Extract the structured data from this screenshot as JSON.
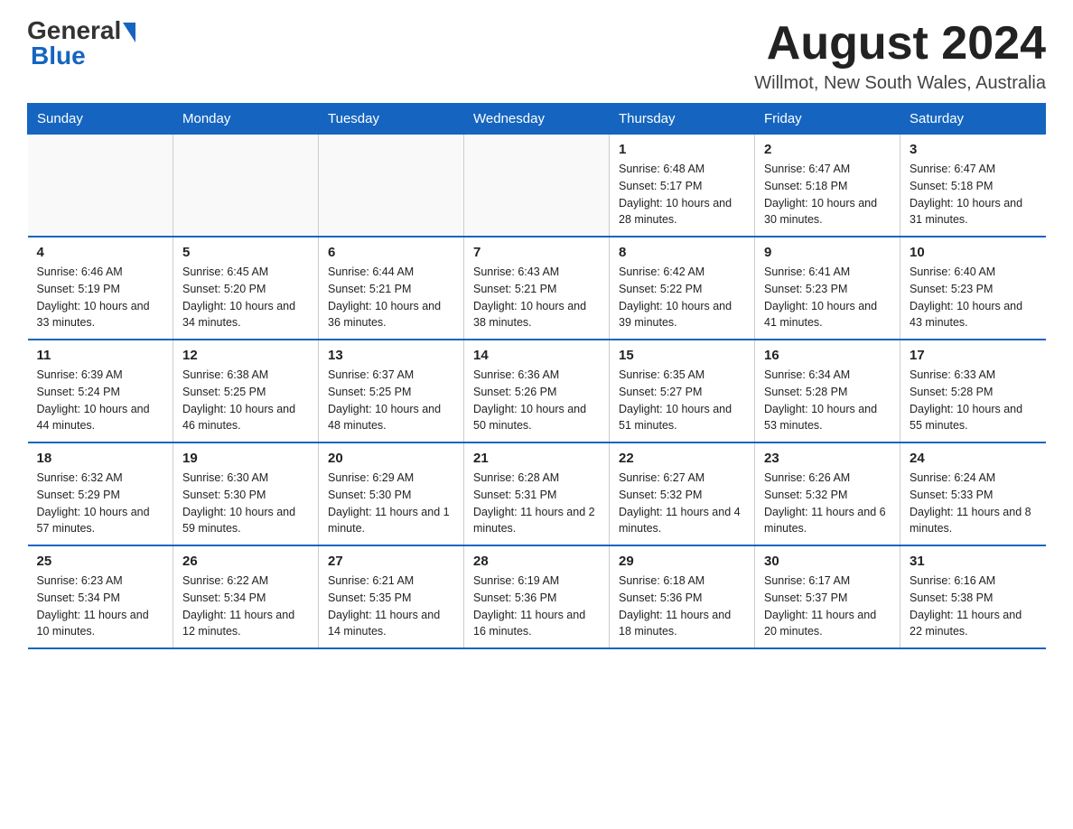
{
  "logo": {
    "general": "General",
    "blue": "Blue"
  },
  "header": {
    "month_year": "August 2024",
    "location": "Willmot, New South Wales, Australia"
  },
  "days_of_week": [
    "Sunday",
    "Monday",
    "Tuesday",
    "Wednesday",
    "Thursday",
    "Friday",
    "Saturday"
  ],
  "weeks": [
    [
      {
        "day": "",
        "info": ""
      },
      {
        "day": "",
        "info": ""
      },
      {
        "day": "",
        "info": ""
      },
      {
        "day": "",
        "info": ""
      },
      {
        "day": "1",
        "info": "Sunrise: 6:48 AM\nSunset: 5:17 PM\nDaylight: 10 hours and 28 minutes."
      },
      {
        "day": "2",
        "info": "Sunrise: 6:47 AM\nSunset: 5:18 PM\nDaylight: 10 hours and 30 minutes."
      },
      {
        "day": "3",
        "info": "Sunrise: 6:47 AM\nSunset: 5:18 PM\nDaylight: 10 hours and 31 minutes."
      }
    ],
    [
      {
        "day": "4",
        "info": "Sunrise: 6:46 AM\nSunset: 5:19 PM\nDaylight: 10 hours and 33 minutes."
      },
      {
        "day": "5",
        "info": "Sunrise: 6:45 AM\nSunset: 5:20 PM\nDaylight: 10 hours and 34 minutes."
      },
      {
        "day": "6",
        "info": "Sunrise: 6:44 AM\nSunset: 5:21 PM\nDaylight: 10 hours and 36 minutes."
      },
      {
        "day": "7",
        "info": "Sunrise: 6:43 AM\nSunset: 5:21 PM\nDaylight: 10 hours and 38 minutes."
      },
      {
        "day": "8",
        "info": "Sunrise: 6:42 AM\nSunset: 5:22 PM\nDaylight: 10 hours and 39 minutes."
      },
      {
        "day": "9",
        "info": "Sunrise: 6:41 AM\nSunset: 5:23 PM\nDaylight: 10 hours and 41 minutes."
      },
      {
        "day": "10",
        "info": "Sunrise: 6:40 AM\nSunset: 5:23 PM\nDaylight: 10 hours and 43 minutes."
      }
    ],
    [
      {
        "day": "11",
        "info": "Sunrise: 6:39 AM\nSunset: 5:24 PM\nDaylight: 10 hours and 44 minutes."
      },
      {
        "day": "12",
        "info": "Sunrise: 6:38 AM\nSunset: 5:25 PM\nDaylight: 10 hours and 46 minutes."
      },
      {
        "day": "13",
        "info": "Sunrise: 6:37 AM\nSunset: 5:25 PM\nDaylight: 10 hours and 48 minutes."
      },
      {
        "day": "14",
        "info": "Sunrise: 6:36 AM\nSunset: 5:26 PM\nDaylight: 10 hours and 50 minutes."
      },
      {
        "day": "15",
        "info": "Sunrise: 6:35 AM\nSunset: 5:27 PM\nDaylight: 10 hours and 51 minutes."
      },
      {
        "day": "16",
        "info": "Sunrise: 6:34 AM\nSunset: 5:28 PM\nDaylight: 10 hours and 53 minutes."
      },
      {
        "day": "17",
        "info": "Sunrise: 6:33 AM\nSunset: 5:28 PM\nDaylight: 10 hours and 55 minutes."
      }
    ],
    [
      {
        "day": "18",
        "info": "Sunrise: 6:32 AM\nSunset: 5:29 PM\nDaylight: 10 hours and 57 minutes."
      },
      {
        "day": "19",
        "info": "Sunrise: 6:30 AM\nSunset: 5:30 PM\nDaylight: 10 hours and 59 minutes."
      },
      {
        "day": "20",
        "info": "Sunrise: 6:29 AM\nSunset: 5:30 PM\nDaylight: 11 hours and 1 minute."
      },
      {
        "day": "21",
        "info": "Sunrise: 6:28 AM\nSunset: 5:31 PM\nDaylight: 11 hours and 2 minutes."
      },
      {
        "day": "22",
        "info": "Sunrise: 6:27 AM\nSunset: 5:32 PM\nDaylight: 11 hours and 4 minutes."
      },
      {
        "day": "23",
        "info": "Sunrise: 6:26 AM\nSunset: 5:32 PM\nDaylight: 11 hours and 6 minutes."
      },
      {
        "day": "24",
        "info": "Sunrise: 6:24 AM\nSunset: 5:33 PM\nDaylight: 11 hours and 8 minutes."
      }
    ],
    [
      {
        "day": "25",
        "info": "Sunrise: 6:23 AM\nSunset: 5:34 PM\nDaylight: 11 hours and 10 minutes."
      },
      {
        "day": "26",
        "info": "Sunrise: 6:22 AM\nSunset: 5:34 PM\nDaylight: 11 hours and 12 minutes."
      },
      {
        "day": "27",
        "info": "Sunrise: 6:21 AM\nSunset: 5:35 PM\nDaylight: 11 hours and 14 minutes."
      },
      {
        "day": "28",
        "info": "Sunrise: 6:19 AM\nSunset: 5:36 PM\nDaylight: 11 hours and 16 minutes."
      },
      {
        "day": "29",
        "info": "Sunrise: 6:18 AM\nSunset: 5:36 PM\nDaylight: 11 hours and 18 minutes."
      },
      {
        "day": "30",
        "info": "Sunrise: 6:17 AM\nSunset: 5:37 PM\nDaylight: 11 hours and 20 minutes."
      },
      {
        "day": "31",
        "info": "Sunrise: 6:16 AM\nSunset: 5:38 PM\nDaylight: 11 hours and 22 minutes."
      }
    ]
  ]
}
